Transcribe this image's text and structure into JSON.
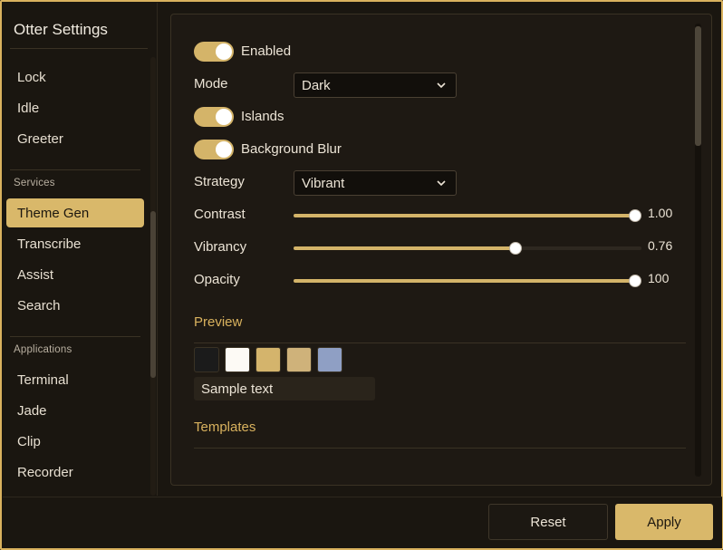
{
  "window": {
    "title": "Otter Settings"
  },
  "sidebar": {
    "items_top": [
      {
        "label": "Lock"
      },
      {
        "label": "Idle"
      },
      {
        "label": "Greeter"
      }
    ],
    "services_label": "Services",
    "services": [
      {
        "label": "Theme Gen",
        "active": true
      },
      {
        "label": "Transcribe"
      },
      {
        "label": "Assist"
      },
      {
        "label": "Search"
      }
    ],
    "applications_label": "Applications",
    "applications": [
      {
        "label": "Terminal"
      },
      {
        "label": "Jade"
      },
      {
        "label": "Clip"
      },
      {
        "label": "Recorder"
      }
    ]
  },
  "settings": {
    "enabled": {
      "label": "Enabled",
      "on": true
    },
    "mode": {
      "label": "Mode",
      "value": "Dark"
    },
    "islands": {
      "label": "Islands",
      "on": true
    },
    "background_blur": {
      "label": "Background Blur",
      "on": true
    },
    "strategy": {
      "label": "Strategy",
      "value": "Vibrant"
    },
    "contrast": {
      "label": "Contrast",
      "value": "1.00",
      "fraction": 1.0
    },
    "vibrancy": {
      "label": "Vibrancy",
      "value": "0.76",
      "fraction": 0.65
    },
    "opacity": {
      "label": "Opacity",
      "value": "100",
      "fraction": 1.0
    }
  },
  "preview": {
    "title": "Preview",
    "swatches": [
      "#1b1b1b",
      "#fdfaf5",
      "#d4b46c",
      "#cfb27a",
      "#8f9fc4"
    ],
    "sample_text": "Sample text"
  },
  "templates": {
    "title": "Templates"
  },
  "footer": {
    "reset_label": "Reset",
    "apply_label": "Apply"
  },
  "colors": {
    "accent": "#d9b86a",
    "background": "#1a1610",
    "panel": "#1e1913"
  }
}
